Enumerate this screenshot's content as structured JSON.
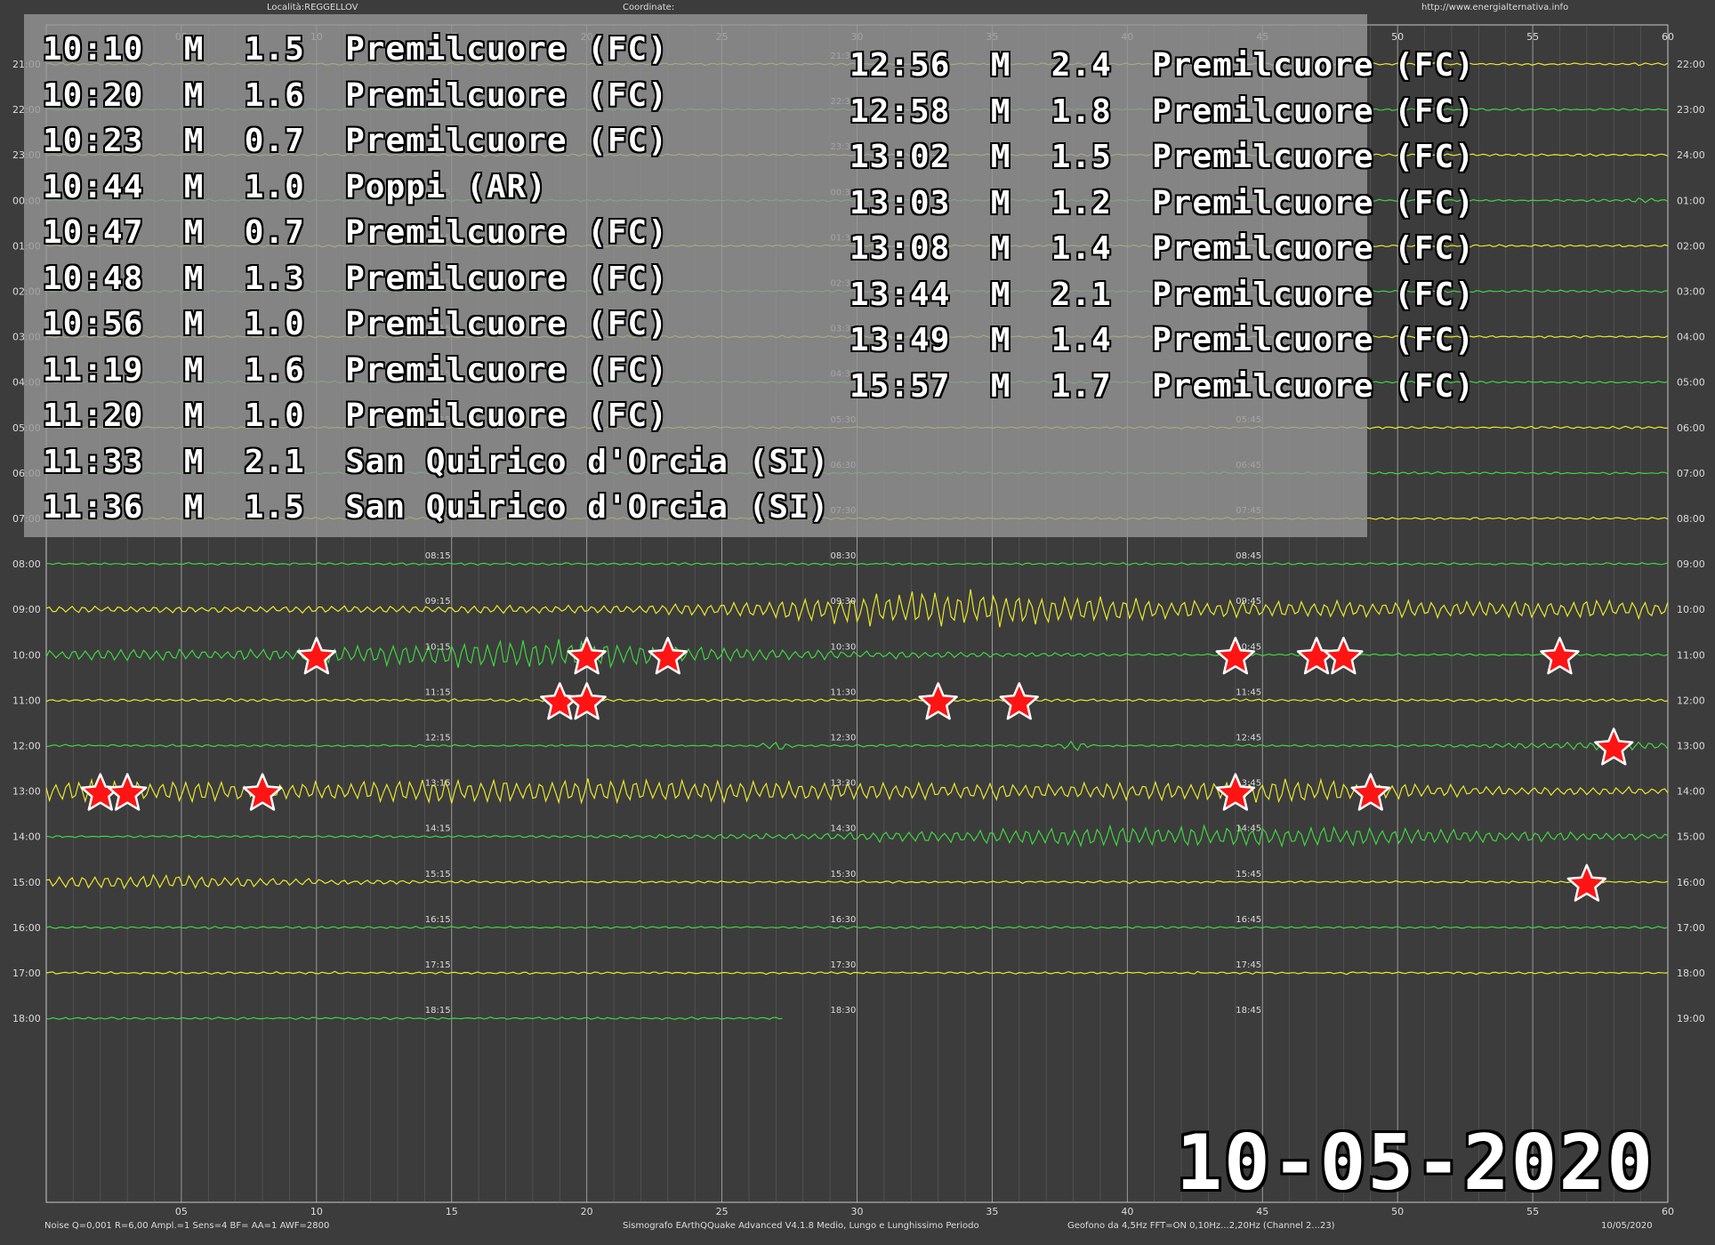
{
  "header": {
    "locality": "Località:REGGELLOV",
    "coordinates": "Coordinate:",
    "website": "http://www.energialternativa.info"
  },
  "axis": {
    "minute_ticks": [
      "05",
      "10",
      "15",
      "20",
      "25",
      "30",
      "35",
      "40",
      "45",
      "50",
      "55",
      "60"
    ],
    "left_hours": [
      "21:00",
      "22:00",
      "23:00",
      "00:00",
      "01:00",
      "02:00",
      "03:00",
      "04:00",
      "05:00",
      "06:00",
      "07:00",
      "08:00",
      "09:00",
      "10:00",
      "11:00",
      "12:00",
      "13:00",
      "14:00",
      "15:00",
      "16:00",
      "17:00",
      "18:00"
    ],
    "right_hours": [
      "22:00",
      "23:00",
      "24:00",
      "01:00",
      "02:00",
      "03:00",
      "04:00",
      "05:00",
      "06:00",
      "07:00",
      "08:00",
      "09:00",
      "10:00",
      "11:00",
      "12:00",
      "13:00",
      "14:00",
      "15:00",
      "16:00",
      "17:00",
      "18:00",
      "19:00"
    ],
    "quarter_labels": {
      "col15": [
        "00:15",
        "01:15",
        "02:15",
        "03:15",
        "04:15",
        "05:15",
        "06:15",
        "07:15",
        "08:15",
        "09:15",
        "10:15",
        "11:15",
        "12:15",
        "13:15",
        "14:15",
        "15:15",
        "16:15",
        "17:15",
        "18:15"
      ],
      "col30": [
        "21:30",
        "22:30",
        "23:30",
        "00:30",
        "01:30",
        "02:30",
        "03:30",
        "04:30",
        "05:30",
        "06:30",
        "07:30",
        "08:30",
        "09:30",
        "10:30",
        "11:30",
        "12:30",
        "13:30",
        "14:30",
        "15:30",
        "16:30",
        "17:30",
        "18:30"
      ],
      "col45": [
        "21:45",
        "22:45",
        "23:45",
        "00:45",
        "01:45",
        "02:45",
        "03:45",
        "04:45",
        "05:45",
        "06:45",
        "07:45",
        "08:45",
        "09:45",
        "10:45",
        "11:45",
        "12:45",
        "13:45",
        "14:45",
        "15:45",
        "16:45",
        "17:45",
        "18:45"
      ]
    }
  },
  "events_left": [
    "10:10  M  1.5  Premilcuore (FC)",
    "10:20  M  1.6  Premilcuore (FC)",
    "10:23  M  0.7  Premilcuore (FC)",
    "10:44  M  1.0  Poppi (AR)",
    "10:47  M  0.7  Premilcuore (FC)",
    "10:48  M  1.3  Premilcuore (FC)",
    "10:56  M  1.0  Premilcuore (FC)",
    "11:19  M  1.6  Premilcuore (FC)",
    "11:20  M  1.0  Premilcuore (FC)",
    "11:33  M  2.1  San Quirico d'Orcia (SI)",
    "11:36  M  1.5  San Quirico d'Orcia (SI)"
  ],
  "events_right": [
    "12:56  M  2.4  Premilcuore (FC)",
    "12:58  M  1.8  Premilcuore (FC)",
    "13:02  M  1.5  Premilcuore (FC)",
    "13:03  M  1.2  Premilcuore (FC)",
    "13:08  M  1.4  Premilcuore (FC)",
    "13:44  M  2.1  Premilcuore (FC)",
    "13:49  M  1.4  Premilcuore (FC)",
    "15:57  M  1.7  Premilcuore (FC)"
  ],
  "markers": [
    {
      "hour": "10:00",
      "minute": 10
    },
    {
      "hour": "10:00",
      "minute": 20
    },
    {
      "hour": "10:00",
      "minute": 23
    },
    {
      "hour": "10:00",
      "minute": 44
    },
    {
      "hour": "10:00",
      "minute": 47
    },
    {
      "hour": "10:00",
      "minute": 48
    },
    {
      "hour": "10:00",
      "minute": 56
    },
    {
      "hour": "11:00",
      "minute": 19
    },
    {
      "hour": "11:00",
      "minute": 20
    },
    {
      "hour": "11:00",
      "minute": 33
    },
    {
      "hour": "11:00",
      "minute": 36
    },
    {
      "hour": "12:00",
      "minute": 58
    },
    {
      "hour": "13:00",
      "minute": 2
    },
    {
      "hour": "13:00",
      "minute": 3
    },
    {
      "hour": "13:00",
      "minute": 8
    },
    {
      "hour": "13:00",
      "minute": 44
    },
    {
      "hour": "13:00",
      "minute": 49
    },
    {
      "hour": "15:00",
      "minute": 57
    }
  ],
  "date_stamp": "10-05-2020",
  "footer": {
    "settings": "Noise Q=0,001 R=6,00 Ampl.=1 Sens=4 BF= AA=1 AWF=2800",
    "software": "Sismografo  EArthQQuake Advanced V4.1.8  Medio, Lungo e Lunghissimo Periodo",
    "sensor": "Geofono da 4,5Hz FFT=ON 0,10Hz...2,20Hz      (Channel 2...23)",
    "date": "10/05/2020"
  },
  "colors": {
    "background": "#3c3c3c",
    "trace_yellow": "#e8e82c",
    "trace_green": "#3ed63e",
    "grid_major": "#c8c8c8",
    "grid_minor": "#6e6e6e",
    "label": "#dcdcdc",
    "marker_fill": "#ff1414",
    "marker_stroke": "#ffffff"
  }
}
